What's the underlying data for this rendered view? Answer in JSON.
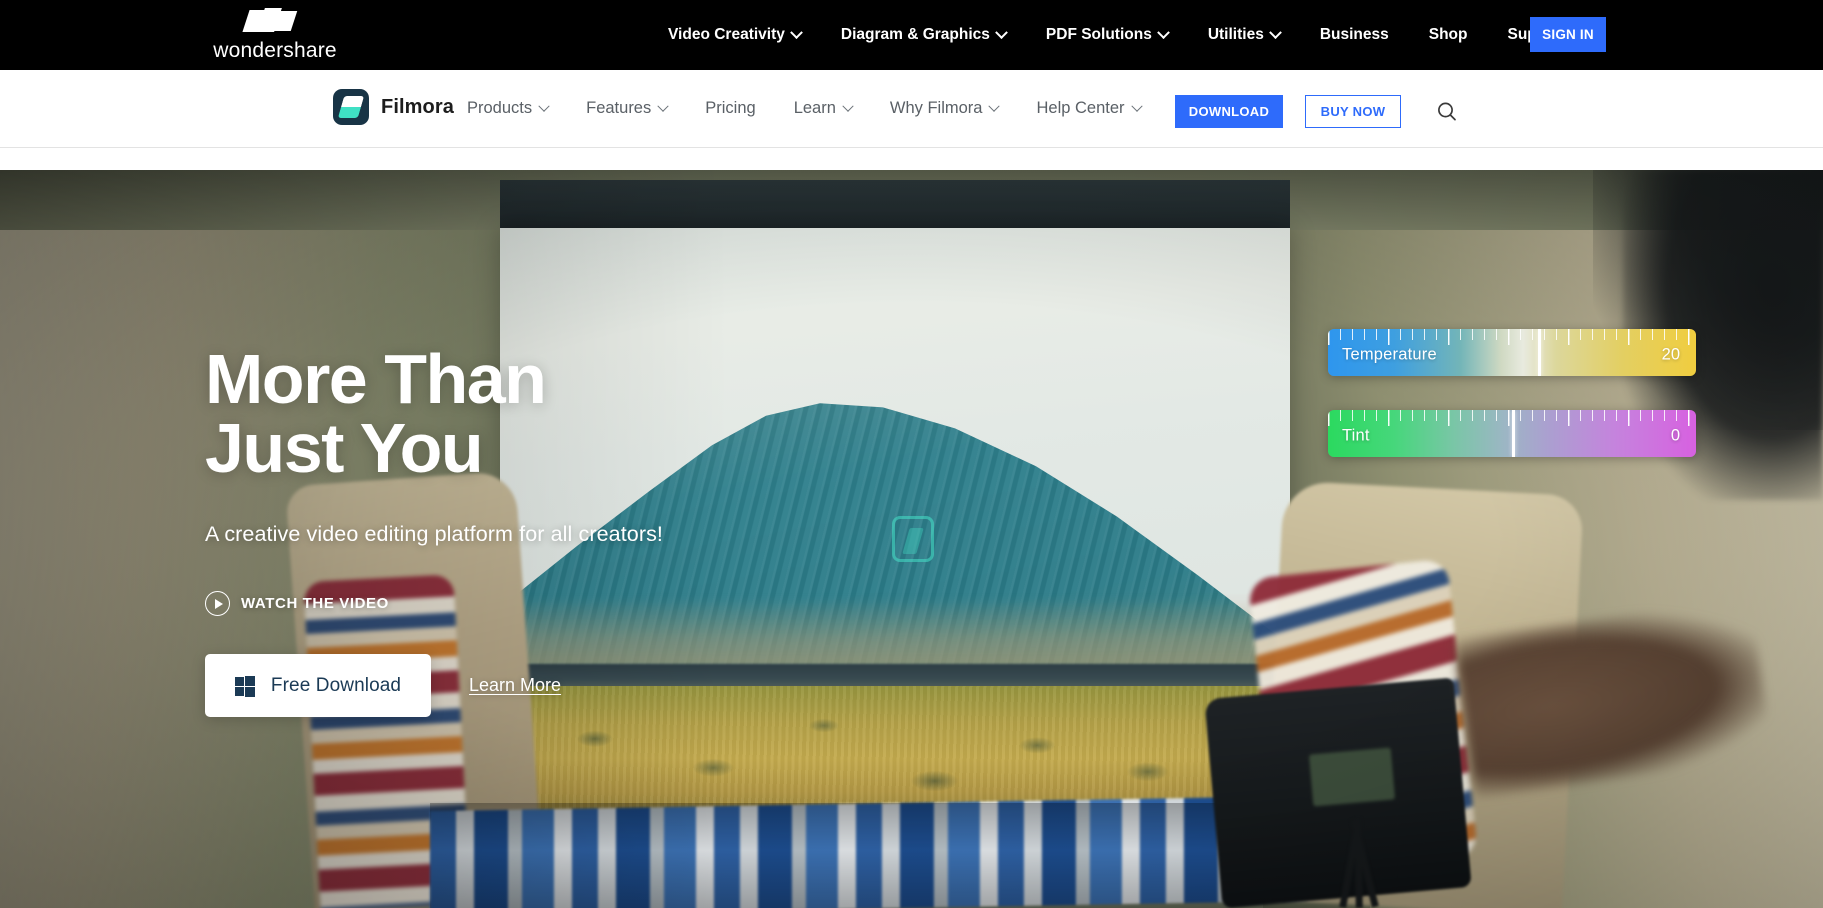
{
  "topbar": {
    "brand": {
      "name": "wondershare",
      "mark_icon": "wondershare-w-icon"
    },
    "nav": [
      {
        "label": "Video Creativity",
        "has_dropdown": true
      },
      {
        "label": "Diagram & Graphics",
        "has_dropdown": true
      },
      {
        "label": "PDF Solutions",
        "has_dropdown": true
      },
      {
        "label": "Utilities",
        "has_dropdown": true
      },
      {
        "label": "Business",
        "has_dropdown": false
      },
      {
        "label": "Shop",
        "has_dropdown": false
      },
      {
        "label": "Support",
        "has_dropdown": false
      }
    ],
    "signin_label": "SIGN IN",
    "background_color": "#000000",
    "accent_color": "#2e6bfb"
  },
  "subnav": {
    "product_name": "Filmora",
    "product_icon": "filmora-diamond-icon",
    "links": [
      {
        "label": "Products",
        "has_dropdown": true
      },
      {
        "label": "Features",
        "has_dropdown": true
      },
      {
        "label": "Pricing",
        "has_dropdown": false
      },
      {
        "label": "Learn",
        "has_dropdown": true
      },
      {
        "label": "Why Filmora",
        "has_dropdown": true
      },
      {
        "label": "Help Center",
        "has_dropdown": true
      }
    ],
    "download_label": "DOWNLOAD",
    "buynow_label": "BUY NOW",
    "search_icon": "search-icon",
    "accent_color": "#2e6bfb"
  },
  "hero": {
    "title": "More Than\nJust You",
    "subtitle": "A creative video editing platform for all creators!",
    "watch_video_label": "WATCH THE VIDEO",
    "play_icon": "play-circle-icon",
    "download_button": {
      "label": "Free Download",
      "platform_icon": "windows-icon"
    },
    "learn_more_label": "Learn More"
  },
  "color_sliders": [
    {
      "name": "Temperature",
      "value": "20",
      "handle_percent": 57,
      "gradient_from": "#2e96ee",
      "gradient_to": "#f0cd3f"
    },
    {
      "name": "Tint",
      "value": "0",
      "handle_percent": 50,
      "gradient_from": "#2bd95f",
      "gradient_to": "#d761e0"
    }
  ]
}
